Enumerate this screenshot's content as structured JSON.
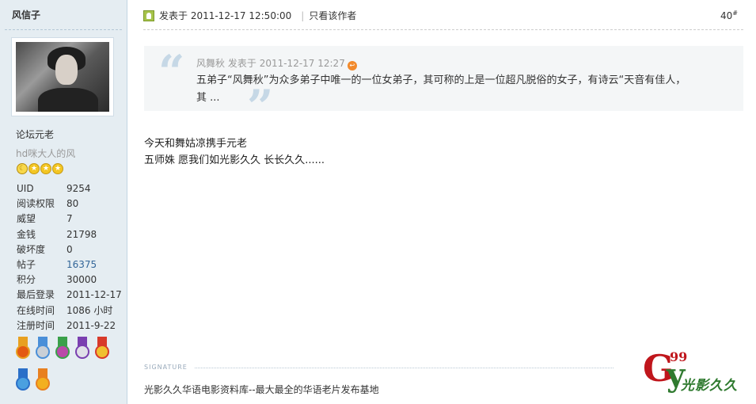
{
  "user": {
    "name": "风信子",
    "rank_title": "论坛元老",
    "custom_title": "hd咪大人的风",
    "stars": [
      "moon",
      "star",
      "star",
      "star"
    ],
    "stats": [
      {
        "label": "UID",
        "value": "9254"
      },
      {
        "label": "阅读权限",
        "value": "80"
      },
      {
        "label": "威望",
        "value": "7"
      },
      {
        "label": "金钱",
        "value": "21798"
      },
      {
        "label": "破坏度",
        "value": "0"
      },
      {
        "label": "帖子",
        "value": "16375",
        "link": true
      },
      {
        "label": "积分",
        "value": "30000"
      },
      {
        "label": "最后登录",
        "value": "2011-12-17"
      },
      {
        "label": "在线时间",
        "value": "1086 小时"
      },
      {
        "label": "注册时间",
        "value": "2011-9-22"
      }
    ],
    "medals": [
      {
        "name": "medal-1",
        "ribbon": "#e8a020",
        "disc": "#e35a12"
      },
      {
        "name": "medal-2",
        "ribbon": "#4a8fd8",
        "disc": "#c9cfd6"
      },
      {
        "name": "medal-3",
        "ribbon": "#3aa04a",
        "disc": "#b94aa8"
      },
      {
        "name": "medal-4",
        "ribbon": "#7a3fb0",
        "disc": "#e0e0e8"
      },
      {
        "name": "medal-5",
        "ribbon": "#d83a2a",
        "disc": "#f0c030"
      },
      {
        "name": "medal-6",
        "ribbon": "#2a6fc8",
        "disc": "#4aa0e0"
      },
      {
        "name": "medal-7",
        "ribbon": "#e88020",
        "disc": "#f2b020"
      }
    ]
  },
  "post": {
    "posted_at": "发表于 2011-12-17 12:50:00",
    "only_author": "只看该作者",
    "floor_number": "40",
    "floor_suffix": "#",
    "quote": {
      "author": "风舞秋",
      "posted_label": "发表于",
      "time": "2011-12-17 12:27",
      "line1": "五弟子“风舞秋”为众多弟子中唯一的一位女弟子，其可称的上是一位超凡脱俗的女子，有诗云“天音有佳人，",
      "line2": "其 ..."
    },
    "content_lines": [
      "今天和舞姑凉携手元老",
      "五师姝 愿我们如光影久久 长长久久......"
    ],
    "signature_label": "SIGNATURE",
    "signature_text": "光影久久华语电影资料库--最大最全的华语老片发布基地"
  },
  "watermark": {
    "letter_g": "G",
    "letter_y": "y",
    "number": "99",
    "text": "光影久久"
  }
}
